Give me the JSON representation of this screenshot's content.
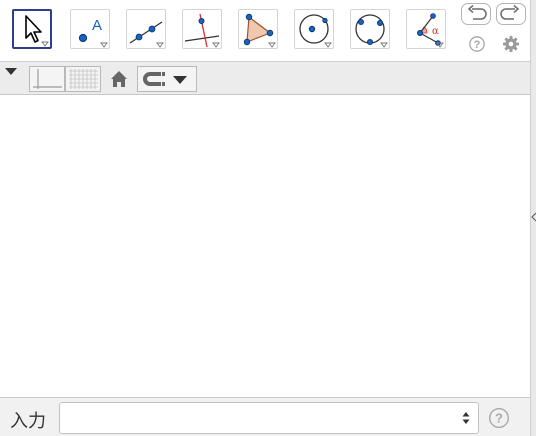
{
  "toolbar": {
    "tools": [
      {
        "name": "move-tool",
        "icon": "arrow-pointer-icon",
        "active": true
      },
      {
        "name": "point-tool",
        "icon": "point-icon",
        "letter": "A"
      },
      {
        "name": "line-tool",
        "icon": "line-through-points-icon"
      },
      {
        "name": "perpendicular-line-tool",
        "icon": "perpendicular-line-icon"
      },
      {
        "name": "polygon-tool",
        "icon": "polygon-icon"
      },
      {
        "name": "circle-center-point-tool",
        "icon": "circle-center-icon"
      },
      {
        "name": "circle-three-points-tool",
        "icon": "circle-three-points-icon"
      },
      {
        "name": "angle-tool",
        "icon": "angle-icon",
        "letter": "α"
      }
    ],
    "undo_icon": "undo-icon",
    "redo_icon": "redo-icon",
    "help_icon": "help-icon",
    "settings_icon": "gear-icon"
  },
  "stylebar": {
    "toggle_icon": "triangle-down-icon",
    "axes_icon": "axes-icon",
    "grid_icon": "grid-icon",
    "home_icon": "home-icon",
    "point_capture_icon": "magnet-icon"
  },
  "input_bar": {
    "label": "入力",
    "value": "",
    "placeholder": ""
  },
  "colors": {
    "active_border": "#2d3f8c",
    "point_blue": "#1565c0",
    "polygon_fill": "#f0c8b0",
    "polygon_stroke": "#a0522d",
    "red_line": "#d32f2f"
  }
}
